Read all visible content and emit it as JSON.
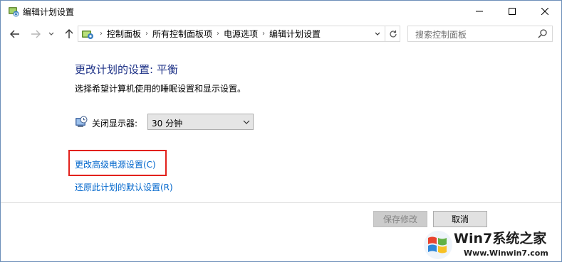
{
  "window": {
    "title": "编辑计划设置",
    "icon": "power-options-icon",
    "controls": [
      "minimize-icon",
      "maximize-icon",
      "close-icon"
    ]
  },
  "nav": {
    "icons": [
      "back-arrow-icon",
      "forward-arrow-icon",
      "recent-chevron-icon",
      "up-arrow-icon"
    ],
    "breadcrumb": [
      "控制面板",
      "所有控制面板项",
      "电源选项",
      "编辑计划设置"
    ],
    "search_placeholder": "搜索控制面板"
  },
  "content": {
    "heading": "更改计划的设置: 平衡",
    "description": "选择希望计算机使用的睡眠设置和显示设置。",
    "display_off_label": "关闭显示器:",
    "display_off_value": "30 分钟",
    "advanced_link": "更改高级电源设置(C)",
    "restore_link": "还原此计划的默认设置(R)",
    "highlight_color": "#e2211c",
    "link_color": "#0066cc",
    "heading_color": "#1e3287"
  },
  "buttons": {
    "save": "保存修改",
    "cancel": "取消"
  },
  "watermark": {
    "brand": "Win7系统之家",
    "url": "Www.Winwin7.com"
  }
}
